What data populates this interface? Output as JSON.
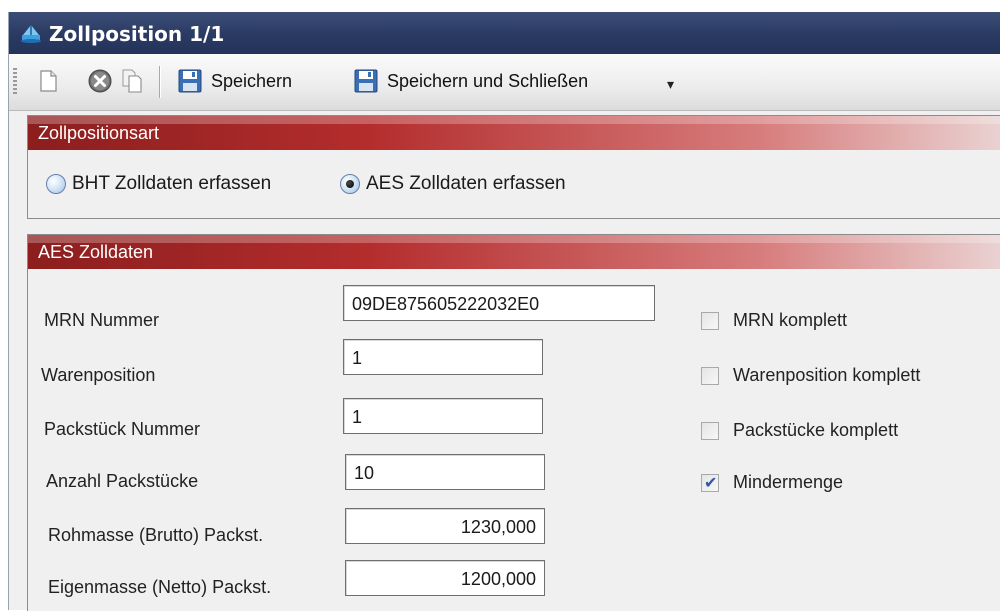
{
  "window": {
    "title": "Zollposition 1/1"
  },
  "toolbar": {
    "save_label": "Speichern",
    "save_close_label": "Speichern und Schließen",
    "icons": [
      "new-document-icon",
      "cancel-icon",
      "copy-document-icon",
      "floppy-disk-icon"
    ]
  },
  "zollpositionsart": {
    "header": "Zollpositionsart",
    "options": [
      {
        "label": "BHT Zolldaten erfassen",
        "checked": false
      },
      {
        "label": "AES Zolldaten erfassen",
        "checked": true
      }
    ]
  },
  "aes": {
    "header": "AES Zolldaten",
    "fields": {
      "mrn": {
        "label": "MRN Nummer",
        "value": "09DE875605222032E0"
      },
      "warenposition": {
        "label": "Warenposition",
        "value": "1"
      },
      "packstueck_nummer": {
        "label": "Packstück Nummer",
        "value": "1"
      },
      "anzahl_packstuecke": {
        "label": "Anzahl Packstücke",
        "value": "10"
      },
      "rohmasse": {
        "label": "Rohmasse (Brutto) Packst.",
        "value": "1230,000"
      },
      "eigenmasse": {
        "label": "Eigenmasse (Netto) Packst.",
        "value": "1200,000"
      }
    },
    "checkboxes": [
      {
        "label": "MRN komplett",
        "checked": false
      },
      {
        "label": "Warenposition komplett",
        "checked": false
      },
      {
        "label": "Packstücke komplett",
        "checked": false
      },
      {
        "label": "Mindermenge",
        "checked": true
      }
    ]
  },
  "colors": {
    "title_bar": "#2a3a62",
    "panel_header": "#b42d2d",
    "check_mark": "#2f56a8"
  }
}
